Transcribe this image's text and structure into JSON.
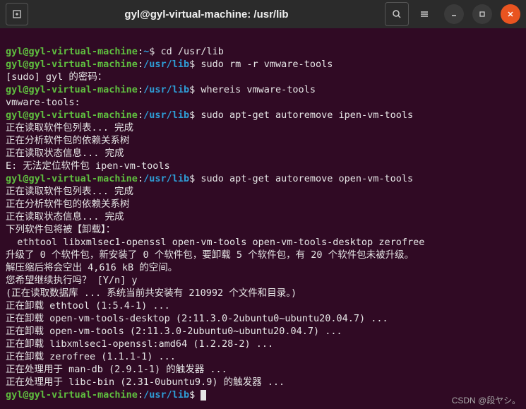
{
  "titlebar": {
    "title": "gyl@gyl-virtual-machine: /usr/lib",
    "new_tab_icon": "new-tab-icon",
    "search_icon": "search-icon",
    "menu_icon": "menu-icon",
    "minimize_icon": "minimize-icon",
    "maximize_icon": "maximize-icon",
    "close_icon": "close-icon"
  },
  "prompt": {
    "user_host": "gyl@gyl-virtual-machine",
    "home_path": "~",
    "lib_path": "/usr/lib",
    "symbol": "$"
  },
  "lines": {
    "cmd1": "cd /usr/lib",
    "cmd2": "sudo rm -r vmware-tools",
    "sudo_pw": "[sudo] gyl 的密码：",
    "cmd3": "whereis vmware-tools",
    "whereis_out": "vmware-tools:",
    "cmd4": "sudo apt-get autoremove ipen-vm-tools",
    "read_list": "正在读取软件包列表... 完成",
    "dep_tree": "正在分析软件包的依赖关系树",
    "read_state": "正在读取状态信息... 完成",
    "err_ipen": "E: 无法定位软件包 ipen-vm-tools",
    "cmd5": "sudo apt-get autoremove open-vm-tools",
    "will_remove": "下列软件包将被【卸载】：",
    "pkgs": "  ethtool libxmlsec1-openssl open-vm-tools open-vm-tools-desktop zerofree",
    "summary": "升级了 0 个软件包，新安装了 0 个软件包，要卸载 5 个软件包，有 20 个软件包未被升级。",
    "space": "解压缩后将会空出 4,616 kB 的空间。",
    "confirm": "您希望继续执行吗？ [Y/n] y",
    "readdb": "(正在读取数据库 ... 系统当前共安装有 210992 个文件和目录。)",
    "rm1": "正在卸载 ethtool (1:5.4-1) ...",
    "rm2": "正在卸载 open-vm-tools-desktop (2:11.3.0-2ubuntu0~ubuntu20.04.7) ...",
    "rm3": "正在卸载 open-vm-tools (2:11.3.0-2ubuntu0~ubuntu20.04.7) ...",
    "rm4": "正在卸载 libxmlsec1-openssl:amd64 (1.2.28-2) ...",
    "rm5": "正在卸载 zerofree (1.1.1-1) ...",
    "trig1": "正在处理用于 man-db (2.9.1-1) 的触发器 ...",
    "trig2": "正在处理用于 libc-bin (2.31-0ubuntu9.9) 的触发器 ..."
  },
  "watermark": "CSDN @段ヤシ。"
}
